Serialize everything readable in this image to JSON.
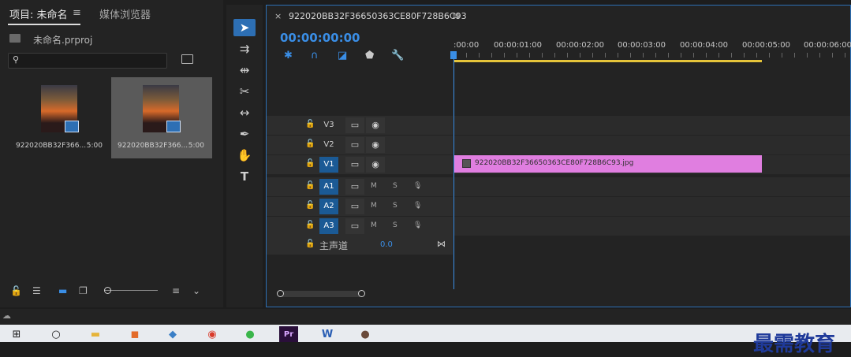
{
  "project_panel": {
    "tab_project": "项目: 未命名",
    "tab_media": "媒体浏览器",
    "menu_glyph": "≡",
    "project_file": "未命名.prproj",
    "items": [
      {
        "name": "922020BB32F366...",
        "duration": "5:00",
        "selected": false
      },
      {
        "name": "922020BB32F366...",
        "duration": "5:00",
        "selected": true
      }
    ]
  },
  "tools": [
    "select-tool",
    "track-select-tool",
    "ripple-edit-tool",
    "razor-tool",
    "slip-tool",
    "pen-tool",
    "hand-tool",
    "type-tool"
  ],
  "timeline": {
    "close_glyph": "×",
    "sequence_name": "922020BB32F36650363CE80F728B6C93",
    "menu_glyph": "≡",
    "timecode": "00:00:00:00",
    "ruler": [
      ":00:00",
      "00:00:01:00",
      "00:00:02:00",
      "00:00:03:00",
      "00:00:04:00",
      "00:00:05:00",
      "00:00:06:00"
    ],
    "tracks": {
      "video": [
        {
          "name": "V3",
          "on": false
        },
        {
          "name": "V2",
          "on": false
        },
        {
          "name": "V1",
          "on": true
        }
      ],
      "audio": [
        {
          "name": "A1",
          "m": "M",
          "s": "S"
        },
        {
          "name": "A2",
          "m": "M",
          "s": "S"
        },
        {
          "name": "A3",
          "m": "M",
          "s": "S"
        }
      ]
    },
    "clip_name": "922020BB32F36650363CE80F728B6C93.jpg",
    "master_label": "主声道",
    "master_value": "0.0"
  },
  "watermark": "最需教育",
  "colors": {
    "accent": "#2d6fb4",
    "timecode": "#3a8ee6",
    "clip": "#e07ee0",
    "workarea": "#e5c43a"
  }
}
